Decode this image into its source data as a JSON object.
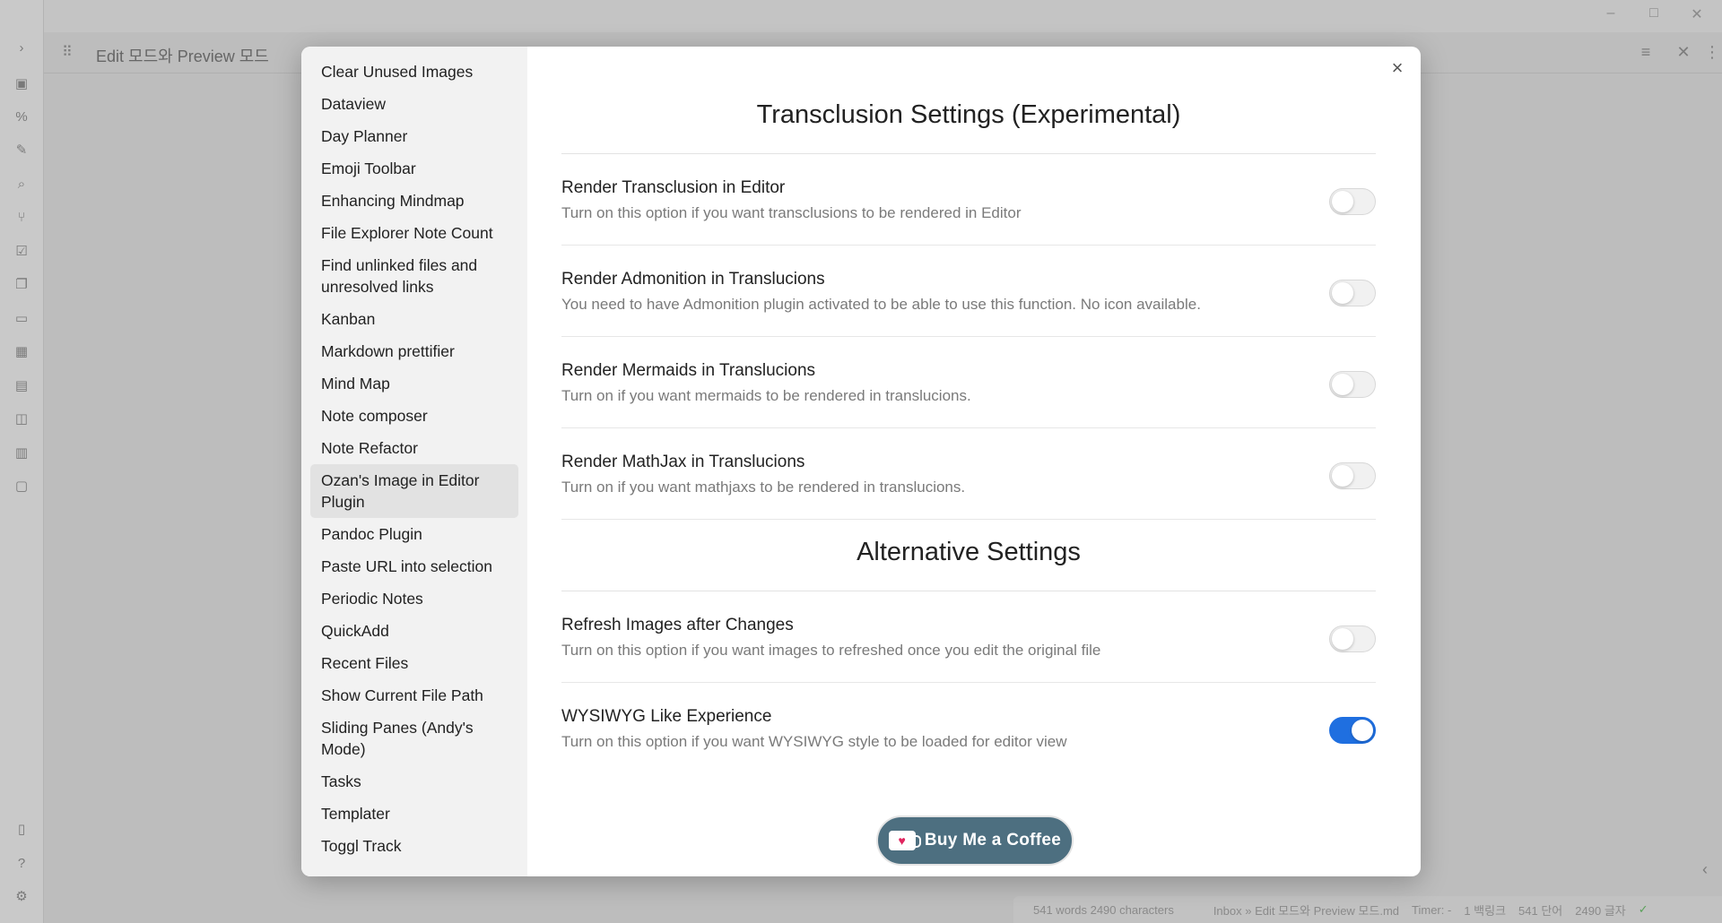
{
  "ribbon": {
    "expand_icon": "›",
    "icons": [
      "image-icon",
      "code-percent-icon",
      "pencil-icon",
      "search-doc-icon",
      "graph-icon",
      "checklist-icon",
      "copy-icon",
      "terminal-icon",
      "blocks-icon",
      "inbox-icon",
      "image-alt-icon",
      "table-icon",
      "calendar-icon"
    ],
    "bottom_icons": [
      "book-icon",
      "help-icon",
      "settings-icon"
    ]
  },
  "tab": {
    "title": "Edit 모드와 Preview 모드"
  },
  "modal": {
    "close_label": "×",
    "sidebar_items": [
      "Clear Unused Images",
      "Dataview",
      "Day Planner",
      "Emoji Toolbar",
      "Enhancing Mindmap",
      "File Explorer Note Count",
      "Find unlinked files and unresolved links",
      "Kanban",
      "Markdown prettifier",
      "Mind Map",
      "Note composer",
      "Note Refactor",
      "Ozan's Image in Editor Plugin",
      "Pandoc Plugin",
      "Paste URL into selection",
      "Periodic Notes",
      "QuickAdd",
      "Recent Files",
      "Show Current File Path",
      "Sliding Panes (Andy's Mode)",
      "Tasks",
      "Templater",
      "Toggl Track"
    ],
    "active_item": "Ozan's Image in Editor Plugin",
    "section1_title": "Transclusion Settings (Experimental)",
    "section1_settings": [
      {
        "name": "Render Transclusion in Editor",
        "desc": "Turn on this option if you want transclusions to be rendered in Editor",
        "enabled": false
      },
      {
        "name": "Render Admonition in Translucions",
        "desc": "You need to have Admonition plugin activated to be able to use this function. No icon available.",
        "enabled": false
      },
      {
        "name": "Render Mermaids in Translucions",
        "desc": "Turn on if you want mermaids to be rendered in translucions.",
        "enabled": false
      },
      {
        "name": "Render MathJax in Translucions",
        "desc": "Turn on if you want mathjaxs to be rendered in translucions.",
        "enabled": false
      }
    ],
    "section2_title": "Alternative Settings",
    "section2_settings": [
      {
        "name": "Refresh Images after Changes",
        "desc": "Turn on this option if you want images to refreshed once you edit the original file",
        "enabled": false
      },
      {
        "name": "WYSIWYG Like Experience",
        "desc": "Turn on this option if you want WYSIWYG style to be loaded for editor view",
        "enabled": true
      }
    ],
    "coffee_label": "Buy Me a Coffee"
  },
  "status": {
    "words": "541 words 2490 characters",
    "path": "Inbox » Edit 모드와 Preview 모드.md",
    "timer": "Timer: -",
    "backlinks": "1 백링크",
    "word_ko": "541 단어",
    "char_ko": "2490 글자",
    "sync": "✓"
  },
  "colors": {
    "accent": "#1f6fe0",
    "coffee_bg": "#4d6f80"
  }
}
